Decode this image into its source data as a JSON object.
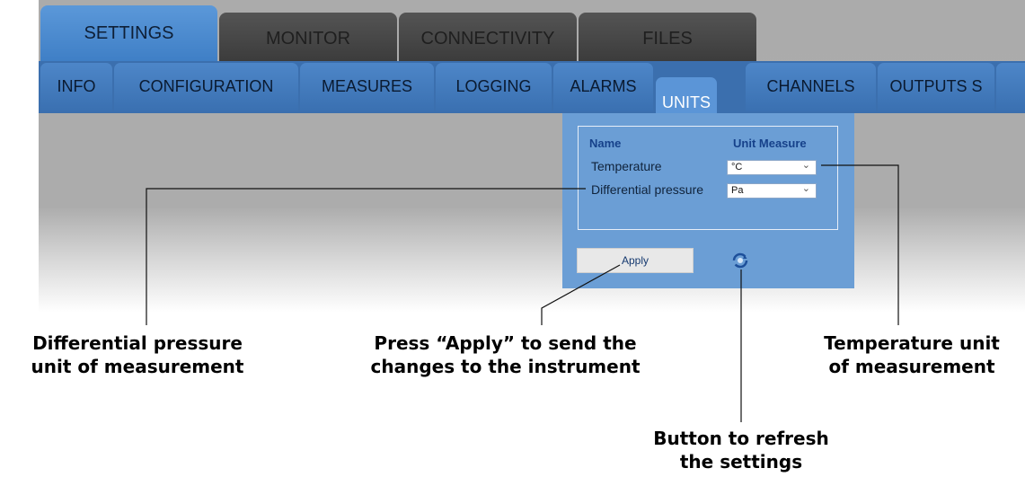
{
  "main_tabs": [
    {
      "label": "SETTINGS",
      "active": true
    },
    {
      "label": "MONITOR",
      "active": false
    },
    {
      "label": "CONNECTIVITY",
      "active": false
    },
    {
      "label": "FILES",
      "active": false
    }
  ],
  "sub_tabs": [
    {
      "label": "INFO",
      "active": false
    },
    {
      "label": "CONFIGURATION",
      "active": false
    },
    {
      "label": "MEASURES",
      "active": false
    },
    {
      "label": "LOGGING",
      "active": false
    },
    {
      "label": "ALARMS",
      "active": false
    },
    {
      "label": "UNITS",
      "active": true
    },
    {
      "label": "CHANNELS",
      "active": false
    },
    {
      "label": "OUTPUTS S",
      "active": false
    }
  ],
  "units_panel": {
    "header_name": "Name",
    "header_unit": "Unit Measure",
    "rows": [
      {
        "name": "Temperature",
        "unit": "°C"
      },
      {
        "name": "Differential pressure",
        "unit": "Pa"
      }
    ],
    "apply_label": "Apply",
    "refresh_icon": "refresh-icon"
  },
  "callouts": {
    "diff_pressure": [
      "Differential pressure",
      "unit of measurement"
    ],
    "apply": [
      "Press “Apply” to send the",
      "changes to the instrument"
    ],
    "temperature": [
      "Temperature unit",
      "of measurement"
    ],
    "refresh": [
      "Button to refresh",
      "the settings"
    ]
  },
  "colors": {
    "active_tab": "#5b98d9",
    "panel": "#6b9ed5",
    "subbar": "#3b6fae"
  }
}
